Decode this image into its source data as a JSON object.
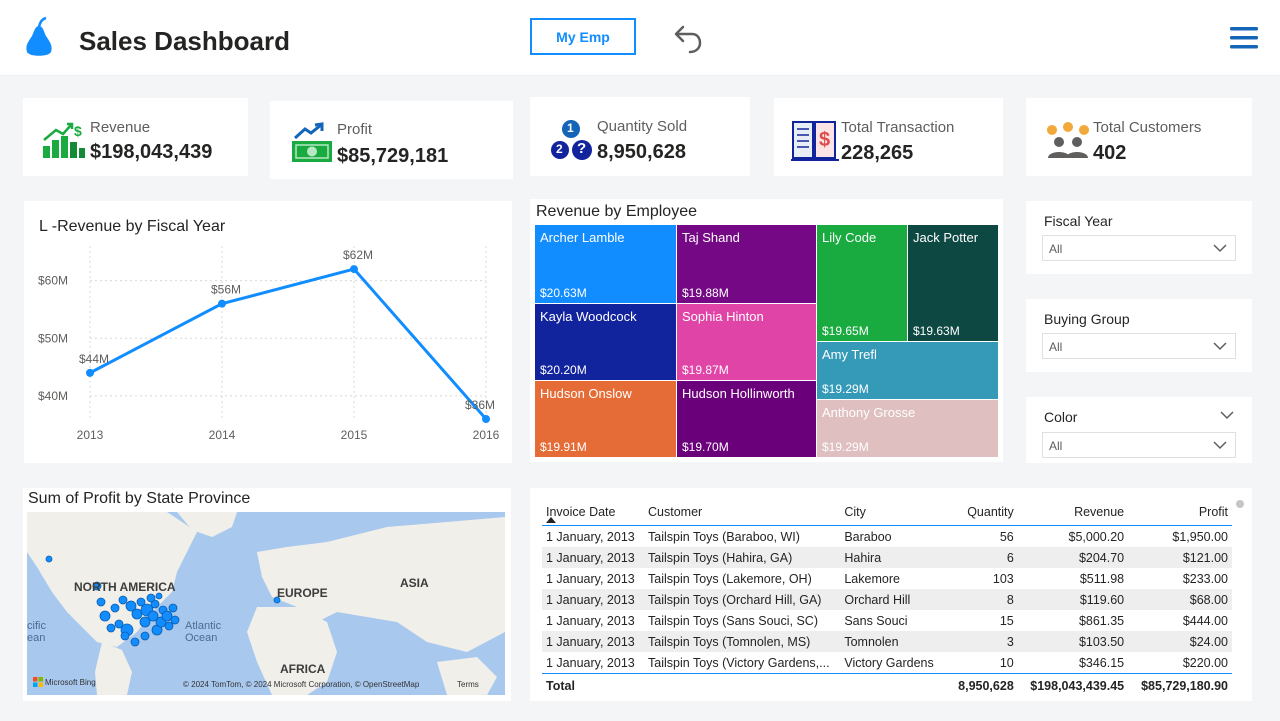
{
  "header": {
    "title": "Sales Dashboard",
    "my_emp_button": "My Emp"
  },
  "kpis": [
    {
      "label": "Revenue",
      "value": "$198,043,439",
      "icon": "revenue-bars-icon"
    },
    {
      "label": "Profit",
      "value": "$85,729,181",
      "icon": "profit-money-icon"
    },
    {
      "label": "Quantity Sold",
      "value": "8,950,628",
      "icon": "quantity-numbers-icon",
      "badges": [
        "1",
        "2",
        "?"
      ]
    },
    {
      "label": "Total Transaction",
      "value": "228,265",
      "icon": "transaction-ledger-icon"
    },
    {
      "label": "Total Customers",
      "value": "402",
      "icon": "customers-group-icon"
    }
  ],
  "line_chart": {
    "title": "L -Revenue by Fiscal Year",
    "y_ticks": [
      "$60M",
      "$50M",
      "$40M"
    ],
    "color": "#118dff"
  },
  "treemap": {
    "title": "Revenue by Employee"
  },
  "chart_data": [
    {
      "type": "line",
      "title": "L -Revenue by Fiscal Year",
      "x": [
        "2013",
        "2014",
        "2015",
        "2016"
      ],
      "values": [
        44,
        56,
        62,
        36
      ],
      "labels": [
        "$44M",
        "$56M",
        "$62M",
        "$36M"
      ],
      "ylim": [
        36,
        66
      ],
      "grid": true
    },
    {
      "type": "treemap",
      "title": "Revenue by Employee",
      "items": [
        {
          "name": "Archer Lamble",
          "value": "$20.63M",
          "color": "#118dff"
        },
        {
          "name": "Taj Shand",
          "value": "$19.88M",
          "color": "#750985"
        },
        {
          "name": "Lily Code",
          "value": "$19.65M",
          "color": "#1aab40"
        },
        {
          "name": "Jack Potter",
          "value": "$19.63M",
          "color": "#0d4842"
        },
        {
          "name": "Kayla Woodcock",
          "value": "$20.20M",
          "color": "#12239e"
        },
        {
          "name": "Sophia Hinton",
          "value": "$19.87M",
          "color": "#e044a7"
        },
        {
          "name": "Amy Trefl",
          "value": "$19.29M",
          "color": "#3599b8"
        },
        {
          "name": "Hudson Onslow",
          "value": "$19.91M",
          "color": "#e66c37"
        },
        {
          "name": "Hudson Hollinworth",
          "value": "$19.70M",
          "color": "#6b007b"
        },
        {
          "name": "Anthony Grosse",
          "value": "$19.29M",
          "color": "#dfbfbf"
        }
      ]
    }
  ],
  "slicers": [
    {
      "title": "Fiscal Year",
      "value": "All"
    },
    {
      "title": "Buying Group",
      "value": "All"
    },
    {
      "title": "Color",
      "value": "All"
    }
  ],
  "map": {
    "title": "Sum of Profit by State Province",
    "labels": {
      "north_america": "NORTH AMERICA",
      "europe": "EUROPE",
      "asia": "ASIA",
      "africa": "AFRICA"
    },
    "ocean": "Atlantic\nOcean",
    "ocean_left": "cific\nean",
    "bing": "Microsoft Bing",
    "copyright": "© 2024 TomTom, © 2024 Microsoft Corporation, © OpenStreetMap",
    "terms": "Terms"
  },
  "table": {
    "columns": [
      "Invoice Date",
      "Customer",
      "City",
      "Quantity",
      "Revenue",
      "Profit"
    ],
    "rows": [
      [
        "1 January, 2013",
        "Tailspin Toys (Baraboo, WI)",
        "Baraboo",
        "56",
        "$5,000.20",
        "$1,950.00"
      ],
      [
        "1 January, 2013",
        "Tailspin Toys (Hahira, GA)",
        "Hahira",
        "6",
        "$204.70",
        "$121.00"
      ],
      [
        "1 January, 2013",
        "Tailspin Toys (Lakemore, OH)",
        "Lakemore",
        "103",
        "$511.98",
        "$233.00"
      ],
      [
        "1 January, 2013",
        "Tailspin Toys (Orchard Hill, GA)",
        "Orchard Hill",
        "8",
        "$119.60",
        "$68.00"
      ],
      [
        "1 January, 2013",
        "Tailspin Toys (Sans Souci, SC)",
        "Sans Souci",
        "15",
        "$861.35",
        "$444.00"
      ],
      [
        "1 January, 2013",
        "Tailspin Toys (Tomnolen, MS)",
        "Tomnolen",
        "3",
        "$103.50",
        "$24.00"
      ],
      [
        "1 January, 2013",
        "Tailspin Toys (Victory Gardens,...",
        "Victory Gardens",
        "10",
        "$346.15",
        "$220.00"
      ]
    ],
    "total": [
      "Total",
      "",
      "",
      "8,950,628",
      "$198,043,439.45",
      "$85,729,180.90"
    ]
  }
}
